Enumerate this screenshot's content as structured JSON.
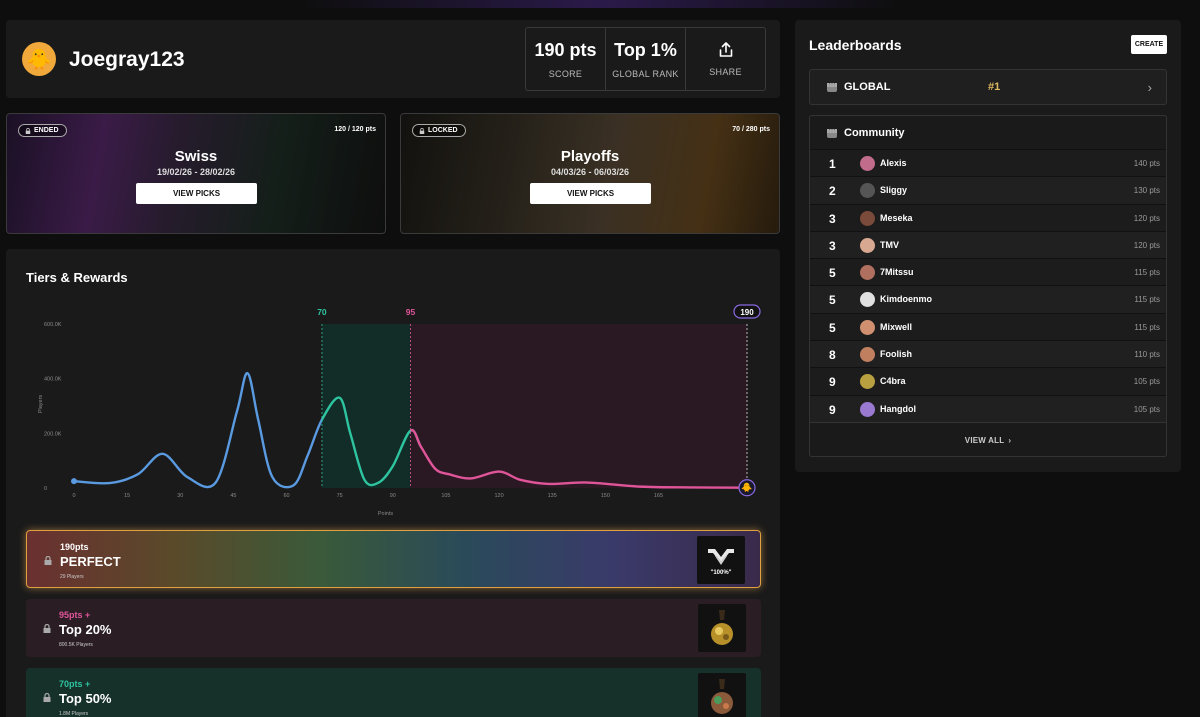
{
  "profile": {
    "username": "Joegray123",
    "avatar_icon": "duck-avatar-icon",
    "score_value": "190 pts",
    "score_label": "SCORE",
    "rank_value": "Top 1%",
    "rank_label": "GLOBAL RANK",
    "share_label": "SHARE"
  },
  "stages": [
    {
      "status": "ENDED",
      "points": "120 / 120 pts",
      "title": "Swiss",
      "dates": "19/02/26 - 28/02/26",
      "button": "VIEW PICKS"
    },
    {
      "status": "LOCKED",
      "points": "70 / 280 pts",
      "title": "Playoffs",
      "dates": "04/03/26 - 06/03/26",
      "button": "VIEW PICKS"
    }
  ],
  "tiers": {
    "title": "Tiers & Rewards",
    "items": [
      {
        "points": "190pts",
        "name": "PERFECT",
        "players": "29 Players",
        "reward_label": "\"100%\""
      },
      {
        "points": "95pts +",
        "name": "Top 20%",
        "players": "800.5K Players"
      },
      {
        "points": "70pts +",
        "name": "Top 50%",
        "players": "1.8M Players"
      }
    ]
  },
  "chart_data": {
    "type": "area",
    "xlabel": "Points",
    "ylabel": "Players",
    "xlim": [
      0,
      190
    ],
    "ylim": [
      0,
      600000
    ],
    "x_ticks": [
      "0",
      "15",
      "30",
      "45",
      "60",
      "75",
      "90",
      "105",
      "120",
      "135",
      "150",
      "165"
    ],
    "y_ticks": [
      "0",
      "200.0K",
      "400.0K",
      "600.0K"
    ],
    "markers": [
      {
        "x": 70,
        "label": "70",
        "color": "#2ec4a0"
      },
      {
        "x": 95,
        "label": "95",
        "color": "#e0559a"
      },
      {
        "x": 190,
        "label": "190",
        "color": "#ffffff"
      }
    ],
    "series": [
      {
        "x": [
          0,
          10,
          18,
          25,
          32,
          40,
          46,
          49,
          52,
          56,
          62,
          66,
          70,
          75,
          78,
          82,
          86,
          90,
          95,
          98,
          102,
          106,
          112,
          120,
          126,
          134,
          145,
          160,
          175,
          190
        ],
        "values": [
          25000,
          18000,
          50000,
          125000,
          40000,
          20000,
          280000,
          420000,
          250000,
          40000,
          10000,
          120000,
          250000,
          330000,
          200000,
          30000,
          20000,
          80000,
          210000,
          150000,
          70000,
          50000,
          35000,
          60000,
          30000,
          15000,
          20000,
          5000,
          2000,
          1000
        ]
      }
    ]
  },
  "leaderboards": {
    "title": "Leaderboards",
    "create_label": "CREATE",
    "global": {
      "name": "GLOBAL",
      "rank": "#1"
    },
    "community": {
      "name": "Community",
      "rows": [
        {
          "rank": "1",
          "name": "Alexis",
          "points": "140 pts",
          "color": "#c26c8c"
        },
        {
          "rank": "2",
          "name": "Sliggy",
          "points": "130 pts",
          "color": "#555555"
        },
        {
          "rank": "3",
          "name": "Meseka",
          "points": "120 pts",
          "color": "#7a4a3a"
        },
        {
          "rank": "3",
          "name": "TMV",
          "points": "120 pts",
          "color": "#d8a890"
        },
        {
          "rank": "5",
          "name": "7Mitssu",
          "points": "115 pts",
          "color": "#b07060"
        },
        {
          "rank": "5",
          "name": "Kimdoenmo",
          "points": "115 pts",
          "color": "#e0e0e0"
        },
        {
          "rank": "5",
          "name": "Mixwell",
          "points": "115 pts",
          "color": "#d09070"
        },
        {
          "rank": "8",
          "name": "Foolish",
          "points": "110 pts",
          "color": "#c08060"
        },
        {
          "rank": "9",
          "name": "C4bra",
          "points": "105 pts",
          "color": "#b8a040"
        },
        {
          "rank": "9",
          "name": "Hangdol",
          "points": "105 pts",
          "color": "#9a7ad0"
        }
      ],
      "view_all": "VIEW ALL"
    }
  }
}
